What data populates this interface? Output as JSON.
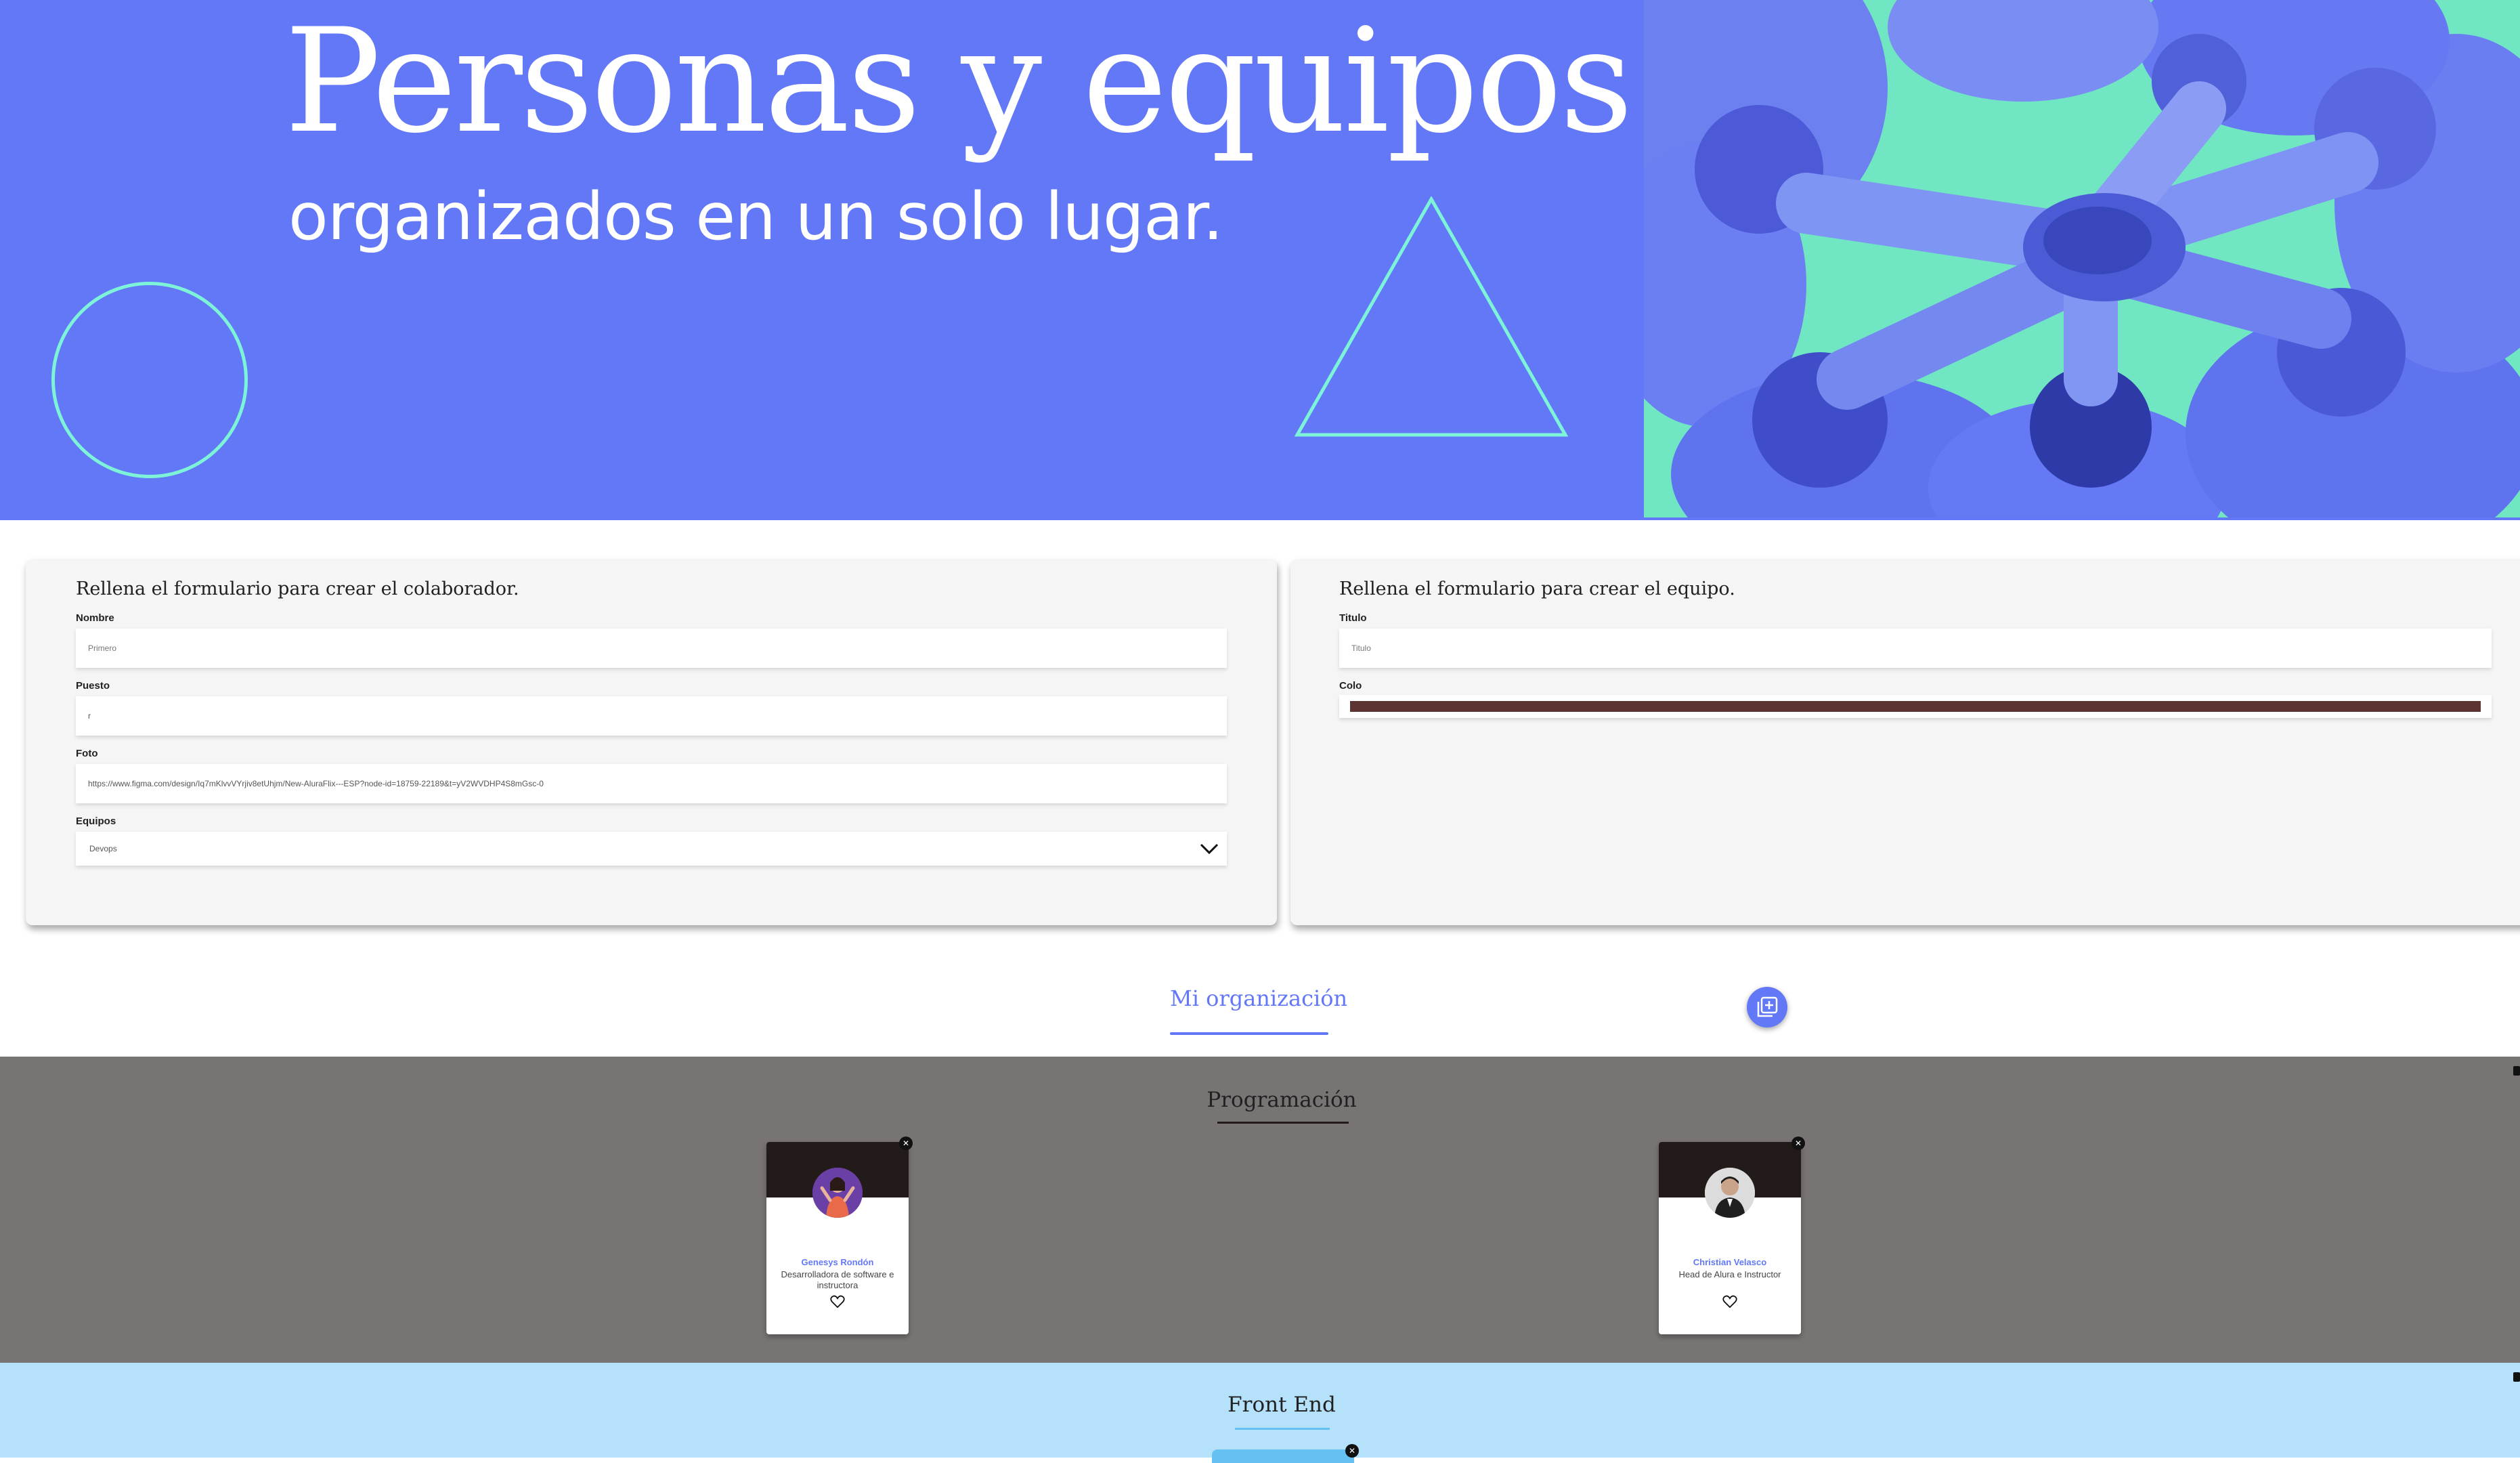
{
  "banner": {
    "title": "Personas y equipos",
    "subtitle": "organizados en un solo lugar."
  },
  "colaborador_form": {
    "title": "Rellena el formulario para crear el colaborador.",
    "fields": [
      {
        "label": "Nombre",
        "placeholder": "Primero",
        "value": ""
      },
      {
        "label": "Puesto",
        "placeholder": "",
        "value": "r"
      },
      {
        "label": "Foto",
        "placeholder": "",
        "value": "https://www.figma.com/design/Iq7mKlvvVYrjiv8etUhjm/New-AluraFlix---ESP?node-id=18759-22189&t=yV2WVDHP4S8mGsc-0"
      },
      {
        "label": "Equipos",
        "value": "Devops"
      }
    ]
  },
  "equipo_form": {
    "title": "Rellena el formulario para crear el equipo.",
    "fields": [
      {
        "label": "Titulo",
        "placeholder": "Titulo",
        "value": ""
      },
      {
        "label": "Colo",
        "value": "#5c3533"
      }
    ]
  },
  "organization": {
    "title": "Mi organización",
    "add_icon": "add-square-icon",
    "accent_color": "#6278f7"
  },
  "teams": [
    {
      "title": "Programación",
      "background": "#787474",
      "accent": "#231a1a",
      "members": [
        {
          "name": "Genesys Rondón",
          "role": "Desarrolladora de software e instructora"
        },
        {
          "name": "Christian Velasco",
          "role": "Head de Alura e Instructor"
        }
      ]
    },
    {
      "title": "Front End",
      "background": "#b5e1fa",
      "accent": "#64c1f1",
      "members": []
    }
  ]
}
